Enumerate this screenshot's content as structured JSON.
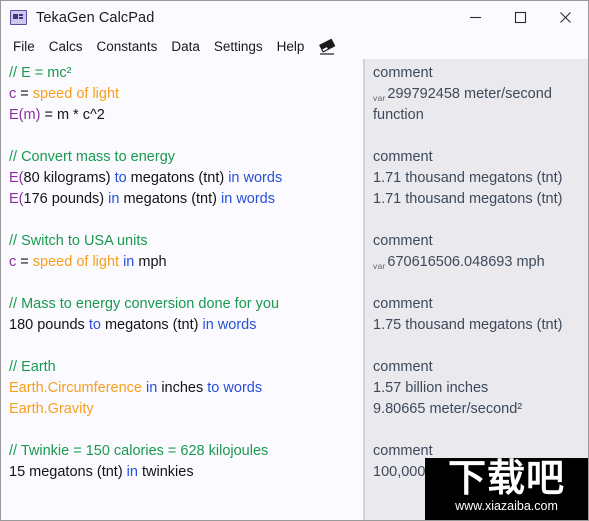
{
  "window": {
    "title": "TekaGen CalcPad",
    "icon": "app-window-icon",
    "controls": [
      {
        "name": "minimize",
        "glyph": "minimize-icon"
      },
      {
        "name": "maximize",
        "glyph": "maximize-icon"
      },
      {
        "name": "close",
        "glyph": "close-icon"
      }
    ]
  },
  "menubar": {
    "items": [
      {
        "label": "File"
      },
      {
        "label": "Calcs"
      },
      {
        "label": "Constants"
      },
      {
        "label": "Data"
      },
      {
        "label": "Settings"
      },
      {
        "label": "Help"
      }
    ],
    "eraser_icon": "eraser-icon"
  },
  "colors": {
    "comment": "#1a9a4f",
    "variable": "#8b2fa0",
    "constant": "#f5a01e",
    "keyword": "#2850d8",
    "plain": "#141414",
    "editor_bg": "#fbfaff",
    "output_bg": "#e9e9ee",
    "output_text": "#3e4a5a",
    "titlebar_bg": "#fbfaff"
  },
  "editor": {
    "lines": [
      {
        "tokens": [
          {
            "t": "// E = mc²",
            "c": "comment"
          }
        ]
      },
      {
        "tokens": [
          {
            "t": "c",
            "c": "var"
          },
          {
            "t": " = ",
            "c": "plain"
          },
          {
            "t": "speed of light",
            "c": "const"
          }
        ]
      },
      {
        "tokens": [
          {
            "t": "E(m)",
            "c": "var"
          },
          {
            "t": " = m * c^2",
            "c": "plain"
          }
        ]
      },
      {
        "tokens": []
      },
      {
        "tokens": [
          {
            "t": "// Convert mass to energy",
            "c": "comment"
          }
        ]
      },
      {
        "tokens": [
          {
            "t": "E(",
            "c": "var"
          },
          {
            "t": "80 kilograms) ",
            "c": "plain"
          },
          {
            "t": "to",
            "c": "kw"
          },
          {
            "t": " megatons (tnt) ",
            "c": "plain"
          },
          {
            "t": "in words",
            "c": "kw"
          }
        ]
      },
      {
        "tokens": [
          {
            "t": "E(",
            "c": "var"
          },
          {
            "t": "176 pounds) ",
            "c": "plain"
          },
          {
            "t": "in",
            "c": "kw"
          },
          {
            "t": " megatons (tnt) ",
            "c": "plain"
          },
          {
            "t": "in words",
            "c": "kw"
          }
        ]
      },
      {
        "tokens": []
      },
      {
        "tokens": [
          {
            "t": "// Switch to USA units",
            "c": "comment"
          }
        ]
      },
      {
        "tokens": [
          {
            "t": "c",
            "c": "var"
          },
          {
            "t": " = ",
            "c": "plain"
          },
          {
            "t": "speed of light",
            "c": "const"
          },
          {
            "t": " ",
            "c": "plain"
          },
          {
            "t": "in",
            "c": "kw"
          },
          {
            "t": " mph",
            "c": "plain"
          }
        ]
      },
      {
        "tokens": []
      },
      {
        "tokens": [
          {
            "t": "// Mass to energy conversion done for you",
            "c": "comment"
          }
        ]
      },
      {
        "tokens": [
          {
            "t": "180 pounds ",
            "c": "plain"
          },
          {
            "t": "to",
            "c": "kw"
          },
          {
            "t": " megatons (tnt) ",
            "c": "plain"
          },
          {
            "t": "in words",
            "c": "kw"
          }
        ]
      },
      {
        "tokens": []
      },
      {
        "tokens": [
          {
            "t": "// Earth",
            "c": "comment"
          }
        ]
      },
      {
        "tokens": [
          {
            "t": "Earth.Circumference",
            "c": "const"
          },
          {
            "t": " ",
            "c": "plain"
          },
          {
            "t": "in",
            "c": "kw"
          },
          {
            "t": " inches ",
            "c": "plain"
          },
          {
            "t": "to words",
            "c": "kw"
          }
        ]
      },
      {
        "tokens": [
          {
            "t": "Earth.Gravity",
            "c": "const"
          }
        ]
      },
      {
        "tokens": []
      },
      {
        "tokens": [
          {
            "t": "// Twinkie = 150 calories = 628 kilojoules",
            "c": "comment"
          }
        ]
      },
      {
        "tokens": [
          {
            "t": "15 megatons (tnt) ",
            "c": "plain"
          },
          {
            "t": "in",
            "c": "kw"
          },
          {
            "t": " twinkies",
            "c": "plain"
          }
        ]
      }
    ]
  },
  "output": {
    "lines": [
      {
        "tag": "",
        "text": "comment"
      },
      {
        "tag": "var",
        "text": "299792458 meter/second"
      },
      {
        "tag": "",
        "text": "function"
      },
      {
        "tag": "",
        "text": ""
      },
      {
        "tag": "",
        "text": "comment"
      },
      {
        "tag": "",
        "text": "1.71 thousand megatons (tnt)"
      },
      {
        "tag": "",
        "text": "1.71 thousand megatons (tnt)"
      },
      {
        "tag": "",
        "text": ""
      },
      {
        "tag": "",
        "text": "comment"
      },
      {
        "tag": "var",
        "text": "670616506.048693 mph"
      },
      {
        "tag": "",
        "text": ""
      },
      {
        "tag": "",
        "text": "comment"
      },
      {
        "tag": "",
        "text": "1.75 thousand megatons (tnt)"
      },
      {
        "tag": "",
        "text": ""
      },
      {
        "tag": "",
        "text": "comment"
      },
      {
        "tag": "",
        "text": "1.57 billion inches"
      },
      {
        "tag": "",
        "text": "9.80665 meter/second²"
      },
      {
        "tag": "",
        "text": ""
      },
      {
        "tag": "",
        "text": "comment"
      },
      {
        "tag": "",
        "text": "100,000,000,0"
      }
    ]
  },
  "watermark": {
    "glyphs": "下载吧",
    "url": "www.xiazaiba.com"
  }
}
